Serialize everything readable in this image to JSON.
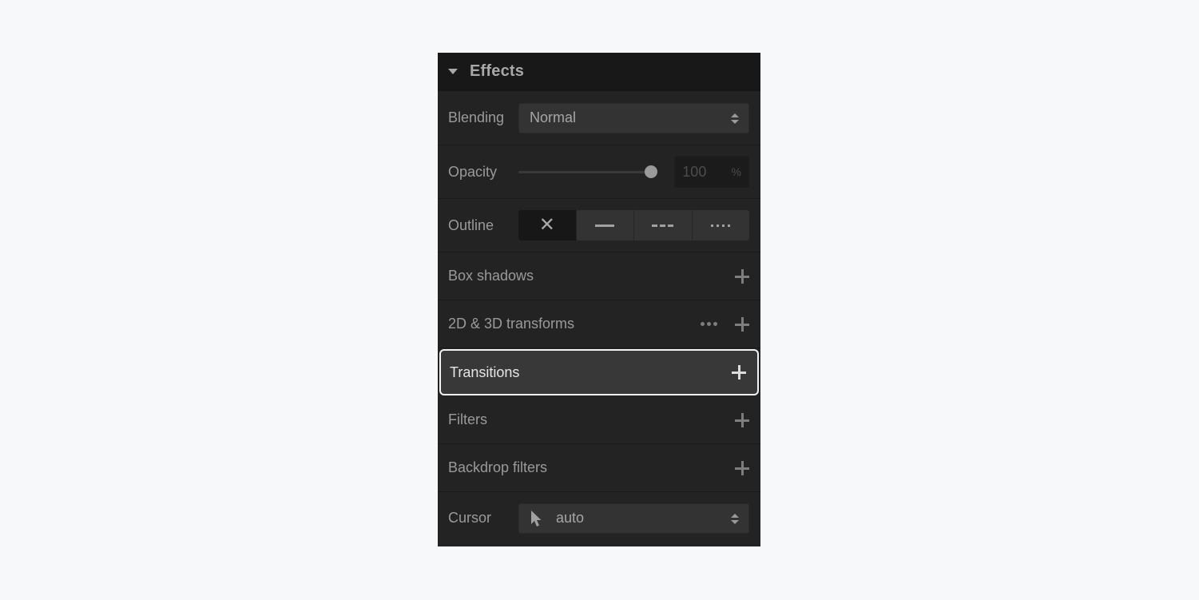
{
  "panel": {
    "title": "Effects",
    "blending": {
      "label": "Blending",
      "value": "Normal"
    },
    "opacity": {
      "label": "Opacity",
      "value": "100",
      "unit": "%",
      "slider_fraction": 1.0
    },
    "outline": {
      "label": "Outline",
      "options": [
        {
          "name": "none",
          "icon": "x-icon",
          "selected": true
        },
        {
          "name": "solid",
          "icon": "solid-line-icon",
          "selected": false
        },
        {
          "name": "dashed",
          "icon": "dashed-line-icon",
          "selected": false
        },
        {
          "name": "dotted",
          "icon": "dotted-line-icon",
          "selected": false
        }
      ]
    },
    "sections": [
      {
        "label": "Box shadows",
        "icons": [
          "plus-icon"
        ]
      },
      {
        "label": "2D & 3D transforms",
        "icons": [
          "more-icon",
          "plus-icon"
        ]
      },
      {
        "label": "Transitions",
        "icons": [
          "plus-icon"
        ],
        "highlighted": true
      },
      {
        "label": "Filters",
        "icons": [
          "plus-icon"
        ]
      },
      {
        "label": "Backdrop filters",
        "icons": [
          "plus-icon"
        ]
      }
    ],
    "cursor": {
      "label": "Cursor",
      "value": "auto",
      "icon": "pointer-arrow-icon"
    }
  },
  "colors": {
    "page_bg": "#f7f8f9",
    "panel_bg": "#232323",
    "header_bg": "#181818",
    "highlight_border": "#f2f2f2"
  }
}
